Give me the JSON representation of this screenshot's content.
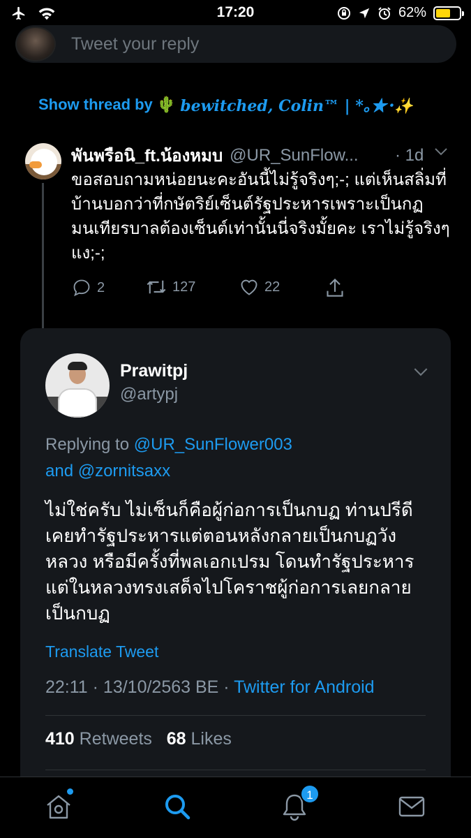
{
  "status_bar": {
    "time": "17:20",
    "battery_percent": "62%",
    "battery_level": 0.62
  },
  "reply_bar": {
    "placeholder": "Tweet your reply"
  },
  "show_thread": {
    "prefix": "Show thread by",
    "emoji": "🌵",
    "name": "𝒃𝒆𝒘𝒊𝒕𝒄𝒉𝒆𝒅, 𝑪𝒐𝒍𝒊𝒏™ | *｡★･✨"
  },
  "parent_tweet": {
    "name": "พันพรือนิ_ft.น้องหมบ",
    "handle": "@UR_SunFlow...",
    "time": "· 1d",
    "text": "ขอสอบถามหน่อยนะคะอันนี้ไม่รู้จริงๆ;-; แต่เห็นสลิ่มที่บ้านบอกว่าที่กษัตริย์เซ็นต์รัฐประหารเพราะเป็นกฏมนเทียรบาลต้องเซ็นต์เท่านั้นนี่จริงมั้ยคะ เราไม่รู้จริงๆแง;-;",
    "replies": "2",
    "retweets": "127",
    "likes": "22"
  },
  "main_tweet": {
    "name": "Prawitpj",
    "handle": "@artypj",
    "replying_prefix": "Replying to",
    "replying_user1": "@UR_SunFlower003",
    "replying_and": "and",
    "replying_user2": "@zornitsaxx",
    "text": "ไม่ใช่ครับ ไม่เซ็นก็คือผู้ก่อการเป็นกบฏ ท่านปรีดีเคยทำรัฐประหารแต่ตอนหลังกลายเป็นกบฏวังหลวง หรือมีครั้งที่พลเอกเปรม โดนทำรัฐประหารแต่ในหลวงทรงเสด็จไปโคราชผู้ก่อการเลยกลายเป็นกบฏ",
    "translate": "Translate Tweet",
    "timestamp": "22:11 · 13/10/2563 BE · ",
    "client": "Twitter for Android",
    "retweets_count": "410",
    "retweets_label": "Retweets",
    "likes_count": "68",
    "likes_label": "Likes"
  },
  "tabbar": {
    "notifications_badge": "1"
  },
  "colors": {
    "accent": "#1d9bf0",
    "background": "#000000",
    "card": "#15181c",
    "muted": "#8b98a5"
  }
}
